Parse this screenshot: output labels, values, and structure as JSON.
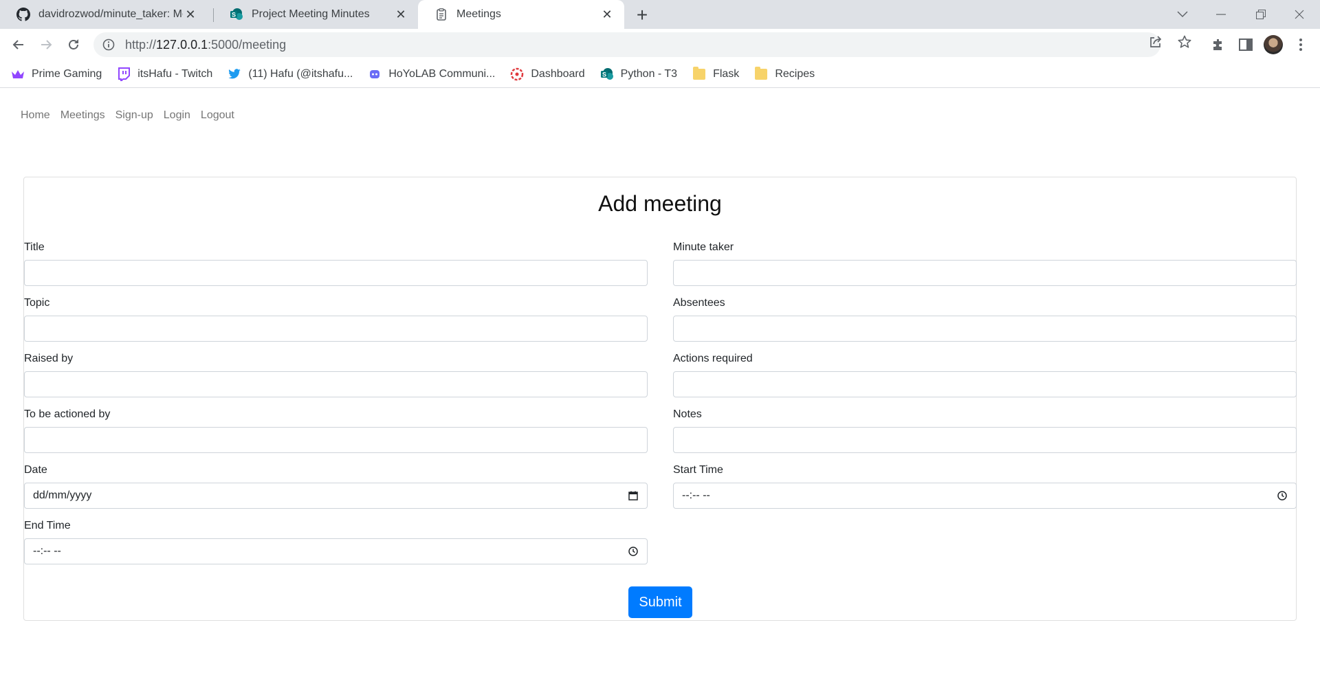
{
  "browser": {
    "tabs": [
      {
        "title": "davidrozwod/minute_taker: Meth",
        "icon": "github-icon"
      },
      {
        "title": "Project Meeting Minutes",
        "icon": "sharepoint-icon"
      },
      {
        "title": "Meetings",
        "icon": "page-icon"
      }
    ],
    "close_glyph": "✕",
    "new_tab_glyph": "+",
    "url_host": "127.0.0.1",
    "url_prefix": "http://",
    "url_rest": ":5000/meeting",
    "bookmarks": [
      {
        "label": "Prime Gaming",
        "icon": "crown-icon"
      },
      {
        "label": "itsHafu - Twitch",
        "icon": "twitch-icon"
      },
      {
        "label": "(11) Hafu (@itshafu...",
        "icon": "twitter-icon"
      },
      {
        "label": "HoYoLAB Communi...",
        "icon": "hoyolab-icon"
      },
      {
        "label": "Dashboard",
        "icon": "dashboard-icon"
      },
      {
        "label": "Python - T3",
        "icon": "sharepoint-icon"
      },
      {
        "label": "Flask",
        "icon": "folder-icon"
      },
      {
        "label": "Recipes",
        "icon": "folder-icon"
      }
    ]
  },
  "nav": {
    "items": [
      "Home",
      "Meetings",
      "Sign-up",
      "Login",
      "Logout"
    ]
  },
  "form": {
    "heading": "Add meeting",
    "fields": {
      "title": {
        "label": "Title",
        "value": ""
      },
      "minute_taker": {
        "label": "Minute taker",
        "value": ""
      },
      "topic": {
        "label": "Topic",
        "value": ""
      },
      "absentees": {
        "label": "Absentees",
        "value": ""
      },
      "raised_by": {
        "label": "Raised by",
        "value": ""
      },
      "actions_required": {
        "label": "Actions required",
        "value": ""
      },
      "to_be_actioned_by": {
        "label": "To be actioned by",
        "value": ""
      },
      "notes": {
        "label": "Notes",
        "value": ""
      },
      "date": {
        "label": "Date",
        "placeholder": "dd/mm/yyyy"
      },
      "start_time": {
        "label": "Start Time",
        "placeholder": "--:-- --"
      },
      "end_time": {
        "label": "End Time",
        "placeholder": "--:-- --"
      }
    },
    "submit_label": "Submit"
  },
  "colors": {
    "primary": "#007bff",
    "tabstrip": "#dee1e6"
  }
}
